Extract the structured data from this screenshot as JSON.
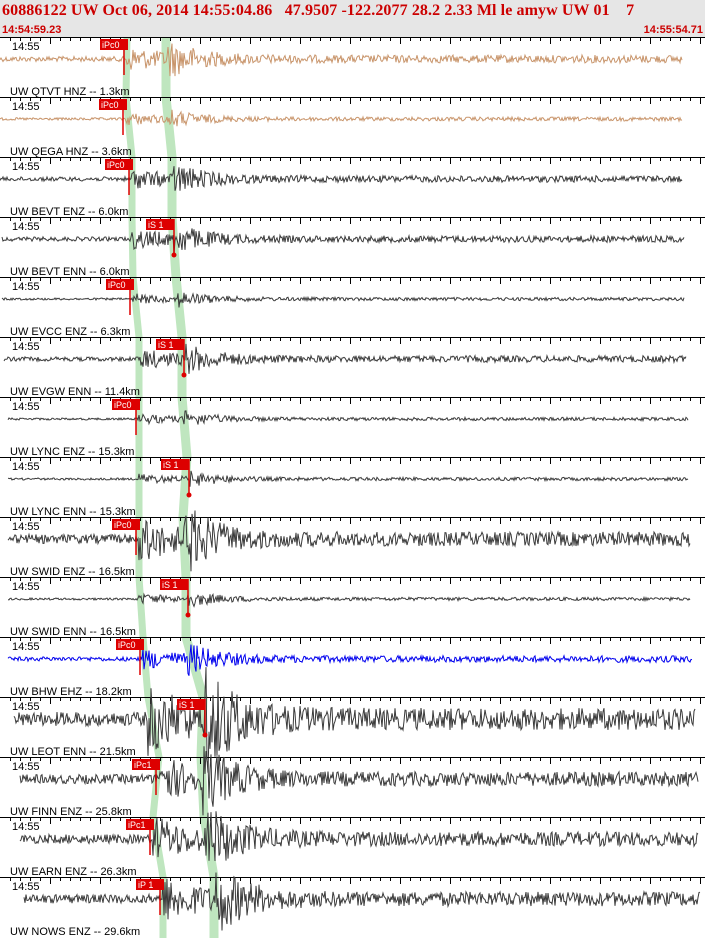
{
  "header": {
    "title": "60886122 UW Oct 06, 2014 14:55:04.86   47.9507 -122.2077 28.2 2.33 Ml le amyw UW 01    7",
    "start_time": "14:54:59.23",
    "end_time": "14:55:54.71"
  },
  "colors": {
    "header_text": "#cc0000",
    "header_bg": "#e6e6e6",
    "pick_box": "#dd0000",
    "pick_window": "#bfe6bf",
    "trace_default": "#3a3a3a",
    "trace_orange": "#c8946a",
    "trace_blue": "#0000ee"
  },
  "chart_data": {
    "type": "seismogram",
    "time_range": [
      "14:54:59.23",
      "14:55:54.71"
    ],
    "panels": [
      {
        "time_label": "14:55",
        "station_label": "UW QTVT HNZ -- 1.3km",
        "color": "orange",
        "amplitude": "medium",
        "picks": [
          {
            "label": "iPc0",
            "type": "P"
          }
        ]
      },
      {
        "time_label": "14:55",
        "station_label": "UW QEGA HNZ -- 3.6km",
        "color": "orange",
        "amplitude": "small",
        "picks": [
          {
            "label": "iPc0",
            "type": "P"
          }
        ]
      },
      {
        "time_label": "14:55",
        "station_label": "UW BEVT ENZ -- 6.0km",
        "color": "default",
        "amplitude": "medium",
        "picks": [
          {
            "label": "iPc0",
            "type": "P"
          }
        ]
      },
      {
        "time_label": "14:55",
        "station_label": "UW BEVT ENN -- 6.0km",
        "color": "default",
        "amplitude": "medium",
        "picks": [
          {
            "label": "iS 1",
            "type": "S"
          }
        ]
      },
      {
        "time_label": "14:55",
        "station_label": "UW EVCC ENZ -- 6.3km",
        "color": "default",
        "amplitude": "small",
        "picks": [
          {
            "label": "iPc0",
            "type": "P"
          }
        ]
      },
      {
        "time_label": "14:55",
        "station_label": "UW EVGW ENN -- 11.4km",
        "color": "default",
        "amplitude": "medium",
        "picks": [
          {
            "label": "iS 1",
            "type": "S"
          }
        ]
      },
      {
        "time_label": "14:55",
        "station_label": "UW LYNC ENZ -- 15.3km",
        "color": "default",
        "amplitude": "small",
        "picks": [
          {
            "label": "iPc0",
            "type": "P"
          }
        ]
      },
      {
        "time_label": "14:55",
        "station_label": "UW LYNC ENN -- 15.3km",
        "color": "default",
        "amplitude": "small",
        "picks": [
          {
            "label": "iS 1",
            "type": "S"
          }
        ]
      },
      {
        "time_label": "14:55",
        "station_label": "UW SWID ENZ -- 16.5km",
        "color": "default",
        "amplitude": "large",
        "picks": [
          {
            "label": "iPc0",
            "type": "P"
          }
        ]
      },
      {
        "time_label": "14:55",
        "station_label": "UW SWID ENN -- 16.5km",
        "color": "default",
        "amplitude": "small",
        "picks": [
          {
            "label": "iS 1",
            "type": "S"
          }
        ]
      },
      {
        "time_label": "14:55",
        "station_label": "UW BHW EHZ -- 18.2km",
        "color": "blue",
        "amplitude": "medium",
        "picks": [
          {
            "label": "iPc0",
            "type": "P"
          }
        ]
      },
      {
        "time_label": "14:55",
        "station_label": "UW LEOT ENN -- 21.5km",
        "color": "default",
        "amplitude": "xlarge",
        "picks": [
          {
            "label": "iS 1",
            "type": "S"
          }
        ]
      },
      {
        "time_label": "14:55",
        "station_label": "UW FINN ENZ -- 25.8km",
        "color": "default",
        "amplitude": "large",
        "picks": [
          {
            "label": "iPc1",
            "type": "P"
          }
        ]
      },
      {
        "time_label": "14:55",
        "station_label": "UW EARN ENZ -- 26.3km",
        "color": "default",
        "amplitude": "large",
        "picks": [
          {
            "label": "iPc1",
            "type": "P"
          }
        ]
      },
      {
        "time_label": "14:55",
        "station_label": "UW NOWS ENZ -- 29.6km",
        "color": "default",
        "amplitude": "large",
        "picks": [
          {
            "label": "iP 1",
            "type": "P"
          }
        ]
      }
    ]
  }
}
